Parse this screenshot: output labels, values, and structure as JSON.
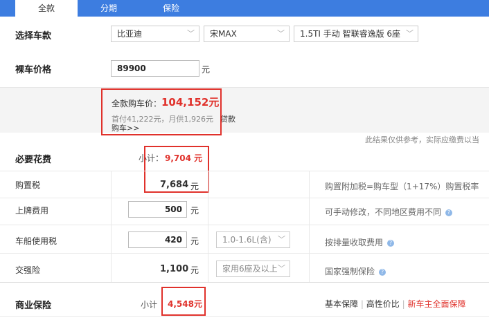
{
  "tabs": [
    {
      "label": "全款",
      "active": true
    },
    {
      "label": "分期",
      "active": false
    },
    {
      "label": "保险",
      "active": false
    }
  ],
  "select_car": {
    "label": "选择车款",
    "brand": "比亚迪",
    "model": "宋MAX",
    "trim": "1.5TI 手动 智联睿逸版 6座"
  },
  "bare_price": {
    "label": "裸车价格",
    "value": "89900",
    "unit": "元"
  },
  "summary": {
    "full_price_label": "全款购车价：",
    "full_price_value": "104,152元",
    "loan_text": "首付41,222元，月供1,926元",
    "loan_link": "贷款",
    "loan_link2": "购车>>",
    "disclaimer": "此结果仅供参考，实际应缴费以当"
  },
  "required": {
    "label": "必要花费",
    "subtotal_label": "小计：",
    "subtotal_value": "9,704 元",
    "rows": {
      "purchase_tax": {
        "label": "购置税",
        "value": "7,684",
        "unit": "元",
        "hint": "购置附加税=购车型（1+17%）购置税率"
      },
      "plate_fee": {
        "label": "上牌费用",
        "value": "500",
        "unit": "元",
        "hint": "可手动修改，不同地区费用不同"
      },
      "vehicle_tax": {
        "label": "车船使用税",
        "value": "420",
        "unit": "元",
        "option": "1.0-1.6L(含)",
        "hint": "按排量收取费用"
      },
      "compulsory": {
        "label": "交强险",
        "value": "1,100",
        "unit": "元",
        "option": "家用6座及以上",
        "hint": "国家强制保险"
      }
    }
  },
  "commercial": {
    "label": "商业保险",
    "subtotal_label": "小计",
    "subtotal_value": "4,548元",
    "links": [
      "基本保障",
      "高性价比",
      "新车主全面保障"
    ],
    "separator": "|"
  },
  "icons": {
    "help": "question-circle-icon",
    "chevron": "chevron-down-icon"
  },
  "colors": {
    "accent": "#3d7de0",
    "highlight": "#e0312b"
  }
}
